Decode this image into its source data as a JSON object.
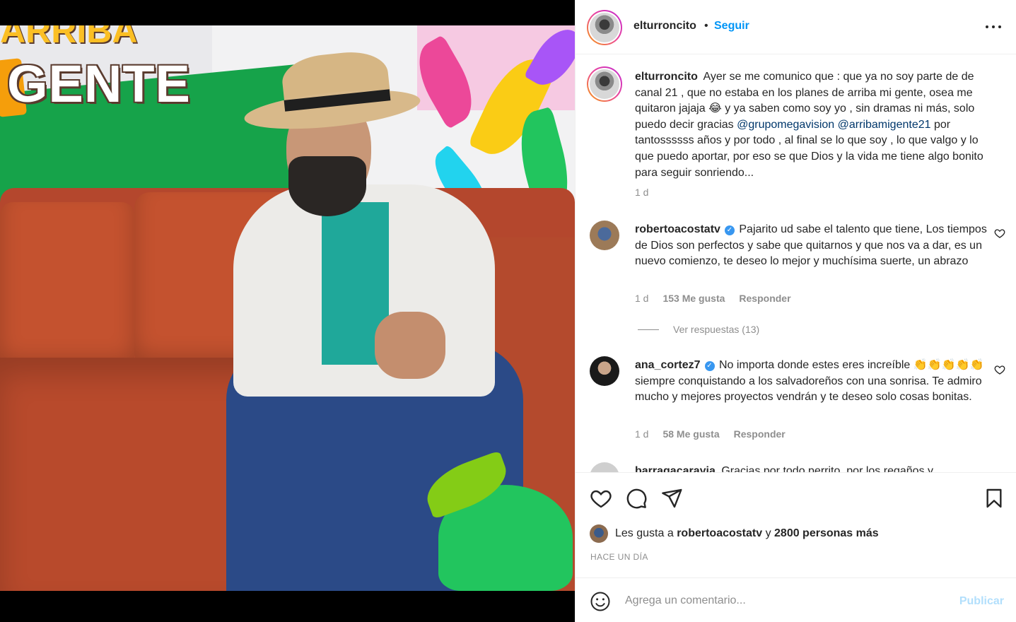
{
  "post": {
    "author": "elturroncito",
    "separator": "•",
    "follow_label": "Seguir",
    "caption": {
      "username": "elturroncito",
      "part1": "Ayer se me comunico que : que ya no soy parte de de canal 21 , que no estaba en los planes de arriba mi gente, osea me quitaron jajaja",
      "emoji1": "😂",
      "part2": "y ya saben como soy yo , sin dramas ni más, solo puedo decir gracias",
      "mention1": "@grupomegavision",
      "mention2": "@arribamigente21",
      "part3": "por tantossssss años y por todo , al final se lo que soy , lo que valgo y lo que puedo aportar, por eso se que Dios y la vida me tiene algo bonito para seguir sonriendo...",
      "age": "1 d"
    },
    "media_sign": {
      "top": "ARRIBA",
      "bottom": "GENTE"
    },
    "comments": [
      {
        "username": "robertoacostatv",
        "verified": true,
        "text": "Pajarito ud sabe el talento que tiene, Los tiempos de Dios son perfectos y sabe que quitarnos y que nos va a dar, es un nuevo comienzo, te deseo lo mejor y muchísima suerte, un abrazo",
        "age": "1 d",
        "likes": "153 Me gusta",
        "reply": "Responder",
        "view_replies": "Ver respuestas (13)"
      },
      {
        "username": "ana_cortez7",
        "verified": true,
        "text_a": "No importa donde estes eres increíble",
        "emoji": "👏👏👏👏👏",
        "text_b": "siempre conquistando a los salvadoreños con una sonrisa. Te admiro mucho y mejores proyectos vendrán y te deseo solo cosas bonitas.",
        "age": "1 d",
        "likes": "58 Me gusta",
        "reply": "Responder"
      },
      {
        "username": "barragacarayia",
        "text": "Gracias por todo perrito, por los regaños y"
      }
    ],
    "liked_by": {
      "prefix": "Les gusta a",
      "user": "robertoacostatv",
      "mid": "y",
      "others": "2800 personas más"
    },
    "timestamp": "HACE UN DÍA",
    "comment_placeholder": "Agrega un comentario...",
    "publish_label": "Publicar"
  },
  "icons": {
    "like": "heart-icon",
    "comment": "comment-bubble-icon",
    "share": "paper-plane-icon",
    "save": "bookmark-icon",
    "emoji": "smiley-icon",
    "more": "more-options-icon",
    "verified": "verified-badge-icon"
  },
  "colors": {
    "link_blue": "#0095f6",
    "mention": "#00376b",
    "muted": "#8e8e8e",
    "publish_disabled": "#b2dffc",
    "verified": "#3897f0"
  }
}
